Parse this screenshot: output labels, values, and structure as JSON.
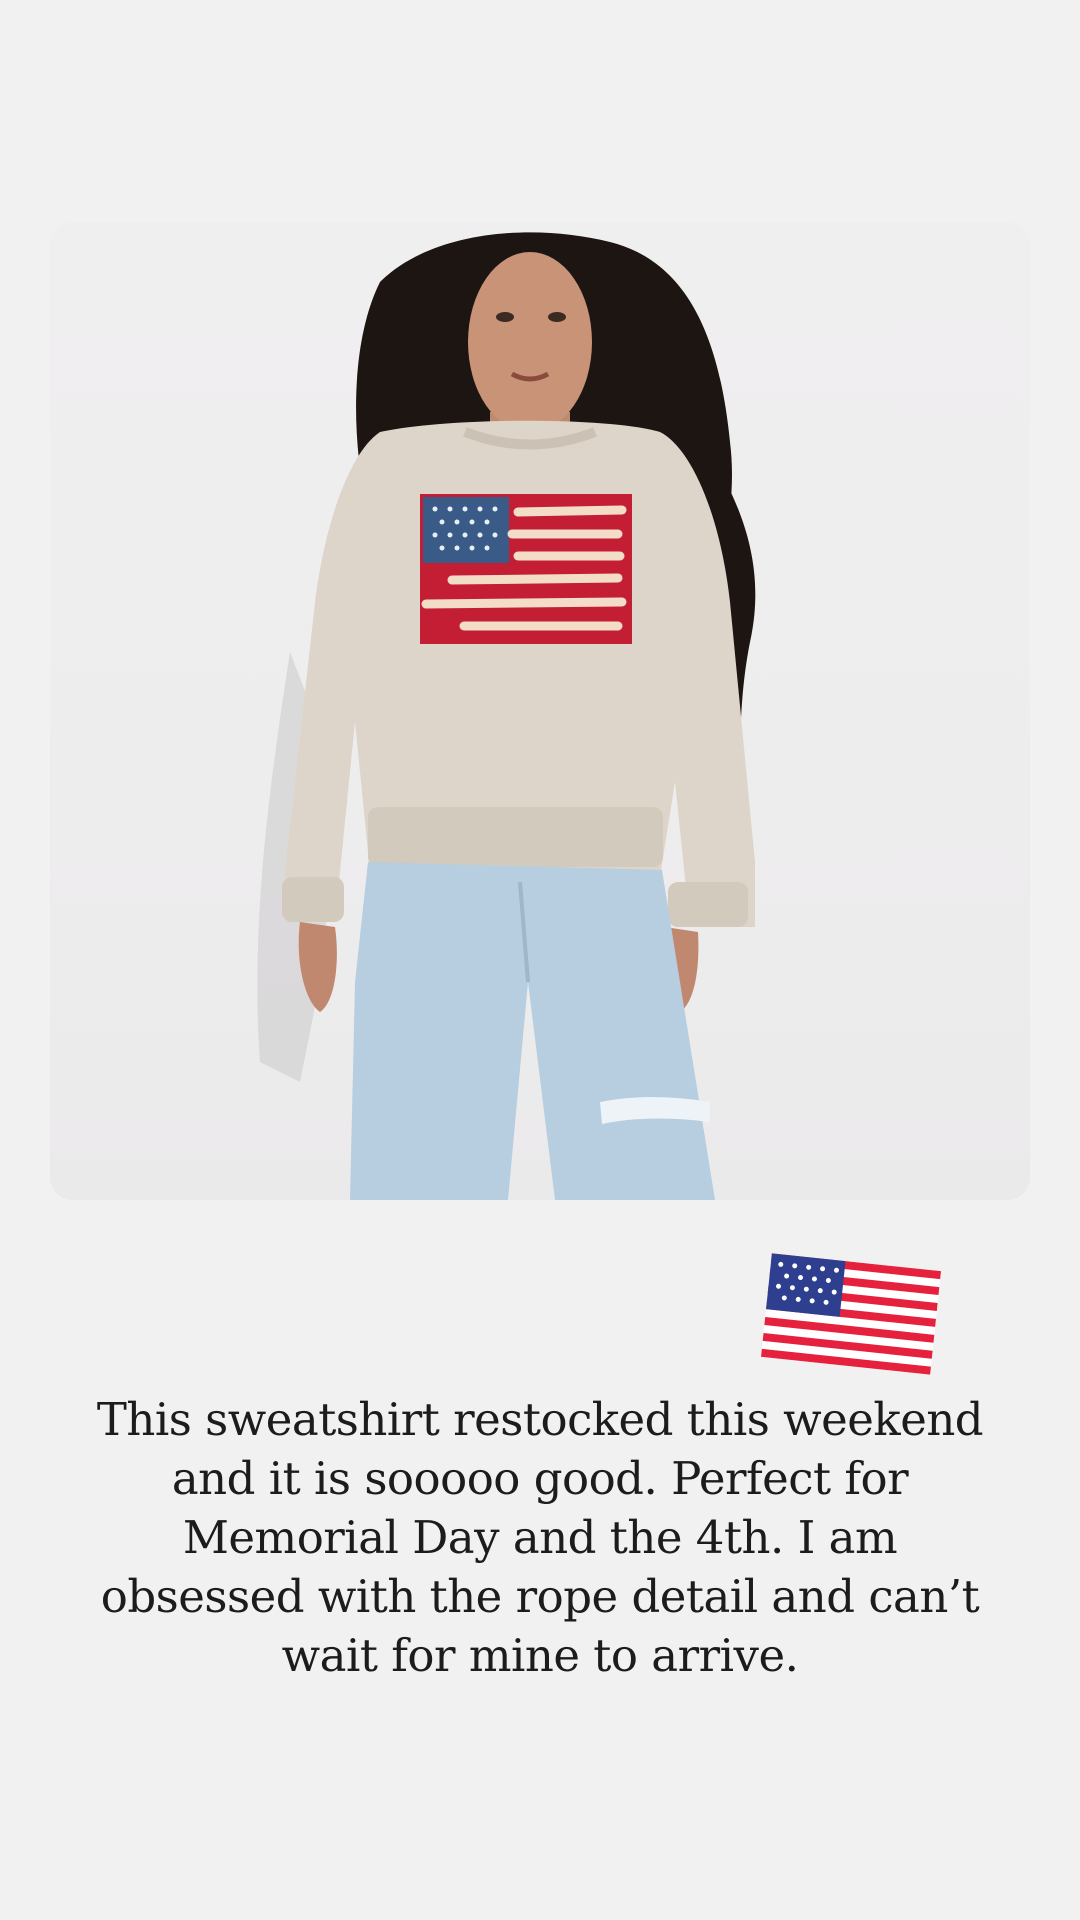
{
  "story": {
    "photo": {
      "description_icon": "model-wearing-flag-sweatshirt-photo",
      "colors": {
        "background": "#f2f1f2",
        "sweatshirt": "#ddd5ca",
        "flag_red": "#c41e34",
        "flag_blue": "#3a5a88",
        "denim": "#b7cde0",
        "hair": "#1c1512",
        "skin": "#c99378"
      }
    },
    "sticker": {
      "icon": "us-flag-emoji-icon"
    },
    "caption": "This sweatshirt restocked this weekend and it is sooooo good. Perfect for Memorial Day and the 4th. I am obsessed with the rope detail and can’t wait for mine to arrive."
  }
}
